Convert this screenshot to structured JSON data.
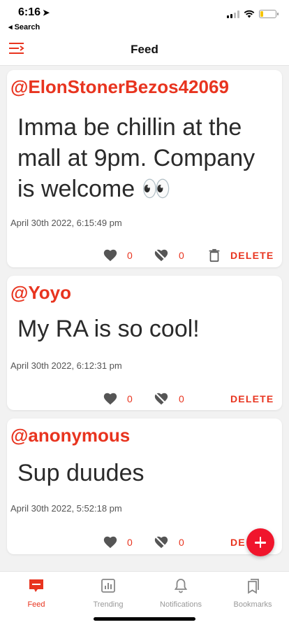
{
  "status_bar": {
    "time": "6:16",
    "back_label": "◂ Search",
    "battery_level": 0.2
  },
  "header": {
    "title": "Feed",
    "menu_icon": "menu-icon"
  },
  "posts": [
    {
      "handle": "@ElonStonerBezos42069",
      "body": "Imma be chillin at the mall at 9pm. Company is welcome 👀",
      "timestamp": "April 30th 2022, 6:15:49 pm",
      "likes": "0",
      "dislikes": "0",
      "delete_label": "DELETE",
      "has_trash": true
    },
    {
      "handle": "@Yoyo",
      "body": "My RA is so cool!",
      "timestamp": "April 30th 2022, 6:12:31 pm",
      "likes": "0",
      "dislikes": "0",
      "delete_label": "DELETE",
      "has_trash": false
    },
    {
      "handle": "@anonymous",
      "body": "Sup duudes",
      "timestamp": "April 30th 2022, 5:52:18 pm",
      "likes": "0",
      "dislikes": "0",
      "delete_label": "DE",
      "has_trash": false
    }
  ],
  "fab": {
    "icon": "plus-icon"
  },
  "tabs": [
    {
      "label": "Feed",
      "icon": "feed-icon",
      "active": true
    },
    {
      "label": "Trending",
      "icon": "chart-icon",
      "active": false
    },
    {
      "label": "Notifications",
      "icon": "bell-icon",
      "active": false
    },
    {
      "label": "Bookmarks",
      "icon": "bookmarks-icon",
      "active": false
    }
  ],
  "colors": {
    "accent": "#e8341f",
    "fab": "#f0152c",
    "background": "#f2f2f2"
  }
}
